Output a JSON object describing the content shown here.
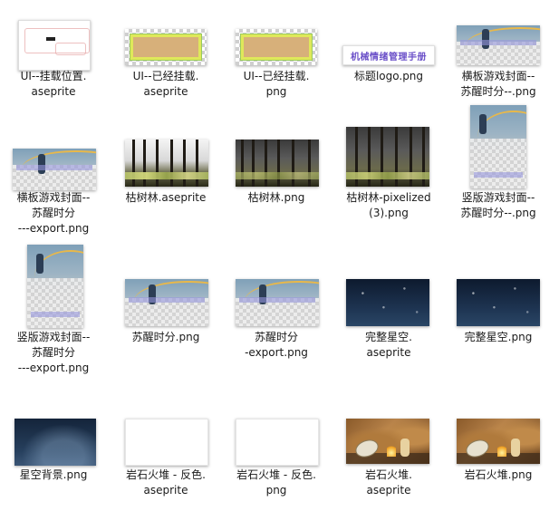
{
  "files": [
    {
      "name": "UI--挂载位置.\naseprite"
    },
    {
      "name": "UI--已经挂载.\naseprite"
    },
    {
      "name": "UI--已经挂载.\npng"
    },
    {
      "name": "标题logo.png",
      "thumb_text": "机械情绪管理手册"
    },
    {
      "name": "横板游戏封面--\n苏醒时分--.png"
    },
    {
      "name": "横板游戏封面--\n苏醒时分\n---export.png"
    },
    {
      "name": "枯树林.aseprite"
    },
    {
      "name": "枯树林.png"
    },
    {
      "name": "枯树林-pixelized\n(3).png"
    },
    {
      "name": "竖版游戏封面--\n苏醒时分--.png"
    },
    {
      "name": "竖版游戏封面--\n苏醒时分\n---export.png"
    },
    {
      "name": "苏醒时分.png"
    },
    {
      "name": "苏醒时分\n-export.png"
    },
    {
      "name": "完整星空.\naseprite"
    },
    {
      "name": "完整星空.png"
    },
    {
      "name": "星空背景.png"
    },
    {
      "name": "岩石火堆 - 反色.\naseprite"
    },
    {
      "name": "岩石火堆 - 反色.\npng"
    },
    {
      "name": "岩石火堆.\naseprite"
    },
    {
      "name": "岩石火堆.png"
    }
  ]
}
